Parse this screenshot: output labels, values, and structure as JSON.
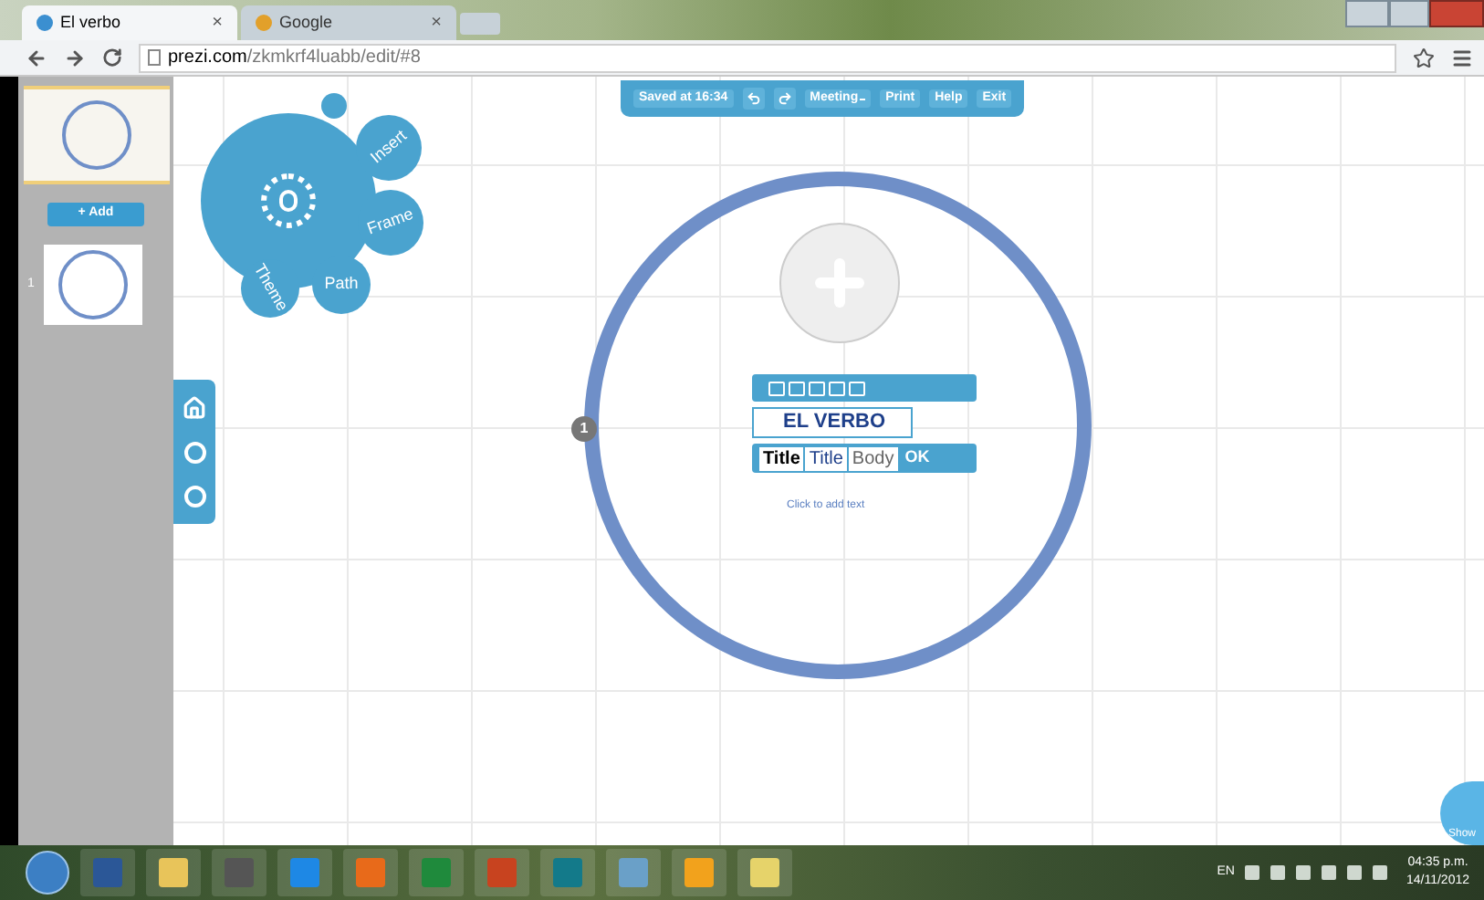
{
  "browser": {
    "tabs": [
      {
        "title": "El verbo",
        "close": "×",
        "selected": true
      },
      {
        "title": "Google",
        "close": "×",
        "selected": false
      }
    ],
    "address": {
      "domain": "prezi.com",
      "path": "/zkmkrf4luabb/edit/#8"
    }
  },
  "sidebar": {
    "add_button": "+ Add",
    "slides": [
      {
        "selected": true
      },
      {
        "number": "1",
        "selected": false
      }
    ]
  },
  "toolbar": {
    "saved": "Saved at 16:34",
    "buttons": [
      {
        "label": "Meeting",
        "dropdown": true
      },
      {
        "label": "Print",
        "dropdown": false
      },
      {
        "label": "Help",
        "dropdown": false
      },
      {
        "label": "Exit",
        "dropdown": false
      }
    ]
  },
  "bubble_menu": [
    "Insert",
    "Frame",
    "Path",
    "Theme"
  ],
  "canvas": {
    "path_number": "1",
    "text_editor": {
      "value": "EL VERBO",
      "styles": [
        {
          "label": "Title",
          "selected": true
        },
        {
          "label": "Title",
          "selected": false
        },
        {
          "label": "Body",
          "selected": false
        }
      ],
      "ok": "OK"
    },
    "hint": "Click to add text",
    "show_button": "Show"
  },
  "taskbar": {
    "language": "EN",
    "time": "04:35 p.m.",
    "date": "14/11/2012"
  }
}
